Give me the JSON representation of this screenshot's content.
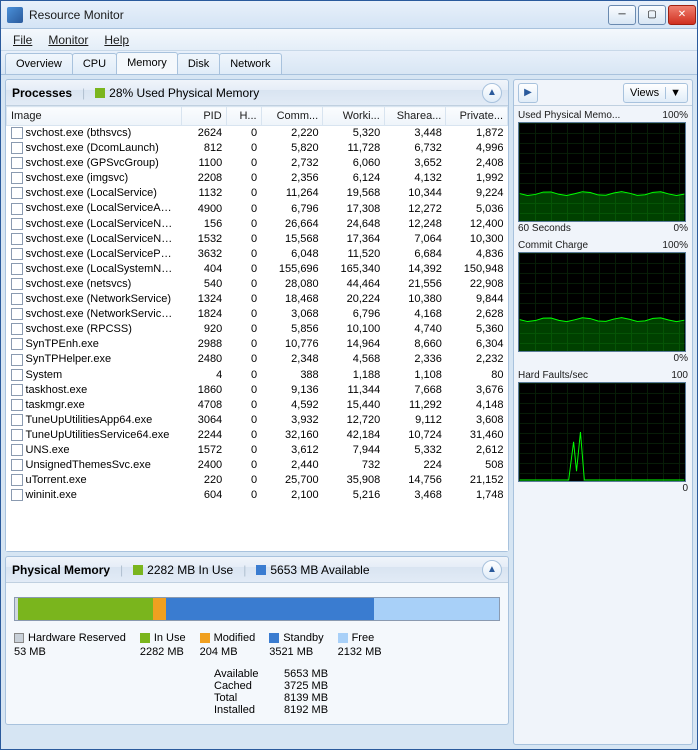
{
  "window": {
    "title": "Resource Monitor"
  },
  "menu": {
    "file": "File",
    "monitor": "Monitor",
    "help": "Help"
  },
  "tabs": [
    "Overview",
    "CPU",
    "Memory",
    "Disk",
    "Network"
  ],
  "active_tab": 2,
  "processes": {
    "title": "Processes",
    "status_pct": "28% Used Physical Memory",
    "columns": [
      "Image",
      "PID",
      "H...",
      "Comm...",
      "Worki...",
      "Sharea...",
      "Private..."
    ],
    "rows": [
      {
        "image": "svchost.exe (bthsvcs)",
        "pid": "2624",
        "h": "0",
        "commit": "2,220",
        "working": "5,320",
        "shareable": "3,448",
        "private": "1,872"
      },
      {
        "image": "svchost.exe (DcomLaunch)",
        "pid": "812",
        "h": "0",
        "commit": "5,820",
        "working": "11,728",
        "shareable": "6,732",
        "private": "4,996"
      },
      {
        "image": "svchost.exe (GPSvcGroup)",
        "pid": "1100",
        "h": "0",
        "commit": "2,732",
        "working": "6,060",
        "shareable": "3,652",
        "private": "2,408"
      },
      {
        "image": "svchost.exe (imgsvc)",
        "pid": "2208",
        "h": "0",
        "commit": "2,356",
        "working": "6,124",
        "shareable": "4,132",
        "private": "1,992"
      },
      {
        "image": "svchost.exe (LocalService)",
        "pid": "1132",
        "h": "0",
        "commit": "11,264",
        "working": "19,568",
        "shareable": "10,344",
        "private": "9,224"
      },
      {
        "image": "svchost.exe (LocalServiceAndNoI...",
        "pid": "4900",
        "h": "0",
        "commit": "6,796",
        "working": "17,308",
        "shareable": "12,272",
        "private": "5,036"
      },
      {
        "image": "svchost.exe (LocalServiceNetwork...",
        "pid": "156",
        "h": "0",
        "commit": "26,664",
        "working": "24,648",
        "shareable": "12,248",
        "private": "12,400"
      },
      {
        "image": "svchost.exe (LocalServiceNoNetw...",
        "pid": "1532",
        "h": "0",
        "commit": "15,568",
        "working": "17,364",
        "shareable": "7,064",
        "private": "10,300"
      },
      {
        "image": "svchost.exe (LocalServicePeerNet)",
        "pid": "3632",
        "h": "0",
        "commit": "6,048",
        "working": "11,520",
        "shareable": "6,684",
        "private": "4,836"
      },
      {
        "image": "svchost.exe (LocalSystemNetwork...",
        "pid": "404",
        "h": "0",
        "commit": "155,696",
        "working": "165,340",
        "shareable": "14,392",
        "private": "150,948"
      },
      {
        "image": "svchost.exe (netsvcs)",
        "pid": "540",
        "h": "0",
        "commit": "28,080",
        "working": "44,464",
        "shareable": "21,556",
        "private": "22,908"
      },
      {
        "image": "svchost.exe (NetworkService)",
        "pid": "1324",
        "h": "0",
        "commit": "18,468",
        "working": "20,224",
        "shareable": "10,380",
        "private": "9,844"
      },
      {
        "image": "svchost.exe (NetworkServiceNetw...",
        "pid": "1824",
        "h": "0",
        "commit": "3,068",
        "working": "6,796",
        "shareable": "4,168",
        "private": "2,628"
      },
      {
        "image": "svchost.exe (RPCSS)",
        "pid": "920",
        "h": "0",
        "commit": "5,856",
        "working": "10,100",
        "shareable": "4,740",
        "private": "5,360"
      },
      {
        "image": "SynTPEnh.exe",
        "pid": "2988",
        "h": "0",
        "commit": "10,776",
        "working": "14,964",
        "shareable": "8,660",
        "private": "6,304"
      },
      {
        "image": "SynTPHelper.exe",
        "pid": "2480",
        "h": "0",
        "commit": "2,348",
        "working": "4,568",
        "shareable": "2,336",
        "private": "2,232"
      },
      {
        "image": "System",
        "pid": "4",
        "h": "0",
        "commit": "388",
        "working": "1,188",
        "shareable": "1,108",
        "private": "80"
      },
      {
        "image": "taskhost.exe",
        "pid": "1860",
        "h": "0",
        "commit": "9,136",
        "working": "11,344",
        "shareable": "7,668",
        "private": "3,676"
      },
      {
        "image": "taskmgr.exe",
        "pid": "4708",
        "h": "0",
        "commit": "4,592",
        "working": "15,440",
        "shareable": "11,292",
        "private": "4,148"
      },
      {
        "image": "TuneUpUtilitiesApp64.exe",
        "pid": "3064",
        "h": "0",
        "commit": "3,932",
        "working": "12,720",
        "shareable": "9,112",
        "private": "3,608"
      },
      {
        "image": "TuneUpUtilitiesService64.exe",
        "pid": "2244",
        "h": "0",
        "commit": "32,160",
        "working": "42,184",
        "shareable": "10,724",
        "private": "31,460"
      },
      {
        "image": "UNS.exe",
        "pid": "1572",
        "h": "0",
        "commit": "3,612",
        "working": "7,944",
        "shareable": "5,332",
        "private": "2,612"
      },
      {
        "image": "UnsignedThemesSvc.exe",
        "pid": "2400",
        "h": "0",
        "commit": "2,440",
        "working": "732",
        "shareable": "224",
        "private": "508"
      },
      {
        "image": "uTorrent.exe",
        "pid": "220",
        "h": "0",
        "commit": "25,700",
        "working": "35,908",
        "shareable": "14,756",
        "private": "21,152"
      },
      {
        "image": "wininit.exe",
        "pid": "604",
        "h": "0",
        "commit": "2,100",
        "working": "5,216",
        "shareable": "3,468",
        "private": "1,748"
      }
    ]
  },
  "physical_memory": {
    "title": "Physical Memory",
    "in_use_label": "2282 MB In Use",
    "available_label": "5653 MB Available",
    "legend": {
      "hardware": {
        "label": "Hardware Reserved",
        "value": "53 MB"
      },
      "inuse": {
        "label": "In Use",
        "value": "2282 MB"
      },
      "modified": {
        "label": "Modified",
        "value": "204 MB"
      },
      "standby": {
        "label": "Standby",
        "value": "3521 MB"
      },
      "free": {
        "label": "Free",
        "value": "2132 MB"
      }
    },
    "stats": {
      "available": {
        "k": "Available",
        "v": "5653 MB"
      },
      "cached": {
        "k": "Cached",
        "v": "3725 MB"
      },
      "total": {
        "k": "Total",
        "v": "8139 MB"
      },
      "installed": {
        "k": "Installed",
        "v": "8192 MB"
      }
    },
    "bar_segments": [
      {
        "w": "0.6%",
        "color": "#d0d8e0"
      },
      {
        "w": "28%",
        "color": "#7ab51d"
      },
      {
        "w": "2.5%",
        "color": "#f0a020"
      },
      {
        "w": "43%",
        "color": "#3a7cd0"
      },
      {
        "w": "25.9%",
        "color": "#a8d0f8"
      }
    ]
  },
  "right": {
    "views_label": "Views",
    "charts": [
      {
        "title": "Used Physical Memo...",
        "max": "100%",
        "foot_l": "60 Seconds",
        "foot_r": "0%",
        "line": 28
      },
      {
        "title": "Commit Charge",
        "max": "100%",
        "foot_l": "",
        "foot_r": "0%",
        "line": 32
      },
      {
        "title": "Hard Faults/sec",
        "max": "100",
        "foot_l": "",
        "foot_r": "0",
        "spike": true
      }
    ]
  },
  "icons": {
    "chev_up": "▲",
    "chev_right": "▶",
    "chev_down": "▼",
    "minimize": "─",
    "maximize": "▢",
    "close": "✕"
  }
}
